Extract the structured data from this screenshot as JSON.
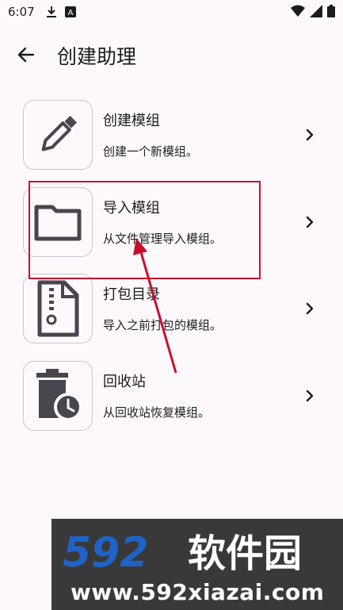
{
  "status": {
    "time": "6:07"
  },
  "app_bar": {
    "title": "创建助理"
  },
  "items": [
    {
      "title": "创建模组",
      "subtitle": "创建一个新模组。",
      "icon": "pencil-icon"
    },
    {
      "title": "导入模组",
      "subtitle": "从文件管理导入模组。",
      "icon": "folder-icon"
    },
    {
      "title": "打包目录",
      "subtitle": "导入之前打包的模组。",
      "icon": "zip-file-icon"
    },
    {
      "title": "回收站",
      "subtitle": "从回收站恢复模组。",
      "icon": "trash-restore-icon"
    }
  ],
  "watermark": {
    "brand": "592软件园",
    "url": "www.592xiazai.com"
  },
  "colors": {
    "annotation": "#c8102e",
    "background": "#fdf8fc",
    "icon": "#49454f"
  }
}
